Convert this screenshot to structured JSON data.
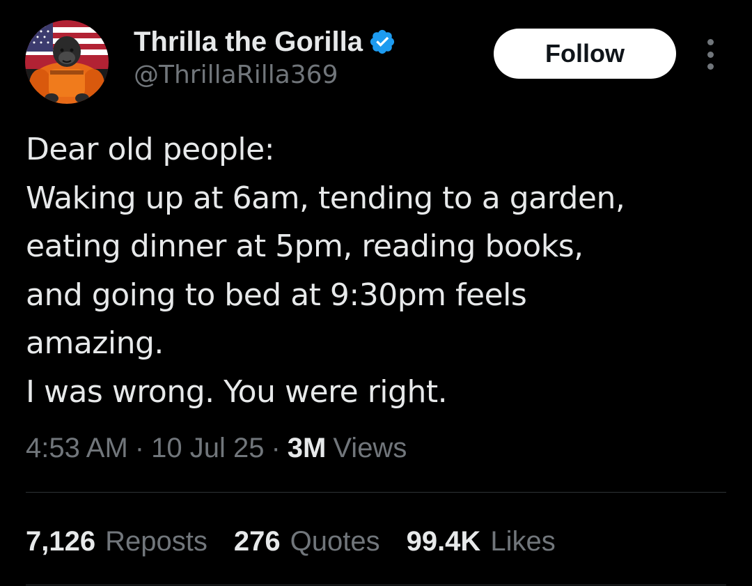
{
  "author": {
    "display_name": "Thrilla the Gorilla",
    "handle": "@ThrillaRilla369",
    "verified": true,
    "avatar_icon": "gorilla-avatar-icon",
    "verified_icon": "verified-badge-icon"
  },
  "actions": {
    "follow_label": "Follow",
    "more_icon": "more-dots-icon"
  },
  "tweet": {
    "lines": [
      "Dear old people:",
      "Waking up at 6am, tending to a garden,",
      "eating dinner at 5pm, reading books,",
      "and going to bed at 9:30pm feels",
      "amazing.",
      "I was wrong. You were right."
    ]
  },
  "meta": {
    "time": "4:53 AM",
    "separator": "·",
    "date": "10 Jul 25",
    "views_count": "3M",
    "views_label": "Views"
  },
  "stats": [
    {
      "count": "7,126",
      "label": "Reposts"
    },
    {
      "count": "276",
      "label": "Quotes"
    },
    {
      "count": "99.4K",
      "label": "Likes"
    }
  ],
  "colors": {
    "background": "#000000",
    "text_primary": "#e7e9ea",
    "text_secondary": "#71767b",
    "divider": "#2f3336",
    "verified_blue": "#1d9bf0",
    "follow_bg": "#ffffff",
    "follow_text": "#0f1419"
  }
}
